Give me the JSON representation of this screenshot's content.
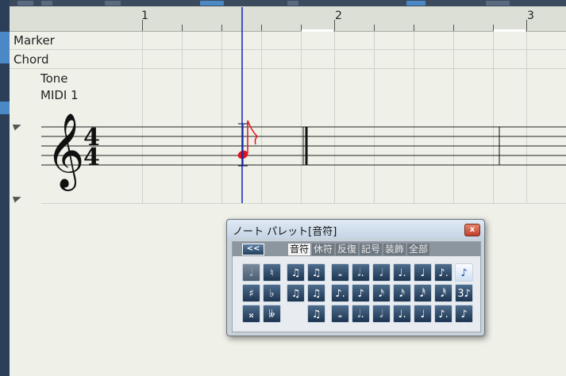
{
  "ruler": {
    "bars": [
      "1",
      "2",
      "3"
    ]
  },
  "tracks": {
    "marker": "Marker",
    "chord": "Chord",
    "tone": "Tone",
    "midi": "MIDI 1"
  },
  "score": {
    "time_signature_top": "4",
    "time_signature_bottom": "4",
    "note_color": "#e0141e",
    "cursor_color": "#1020c0"
  },
  "palette": {
    "title": "ノート パレット[音符]",
    "close": "x",
    "back": "<<",
    "tabs": [
      "音符",
      "休符",
      "反復",
      "記号",
      "装飾",
      "全部"
    ],
    "active_tab": "音符",
    "accidentals": [
      "𝅗𝅥",
      "♮",
      "♯",
      "♭",
      "𝄪",
      "𝄫"
    ],
    "tuplets": [
      "♫",
      "♫",
      "♫",
      "♫",
      "♫",
      "♫"
    ],
    "notes_row1": [
      "𝅝",
      "𝅗𝅥.",
      "𝅗𝅥",
      "♩.",
      "♩",
      "♪.",
      "♪"
    ],
    "notes_row2": [
      "♪.",
      "♪",
      "𝅘𝅥𝅯",
      "𝅘𝅥𝅯",
      "𝅘𝅥𝅰",
      "𝅘𝅥𝅰",
      "3♪"
    ],
    "notes_row3": [
      "𝅝",
      "𝅗𝅥.",
      "𝅗𝅥",
      "♩.",
      "♩",
      "♪.",
      "♪"
    ]
  }
}
